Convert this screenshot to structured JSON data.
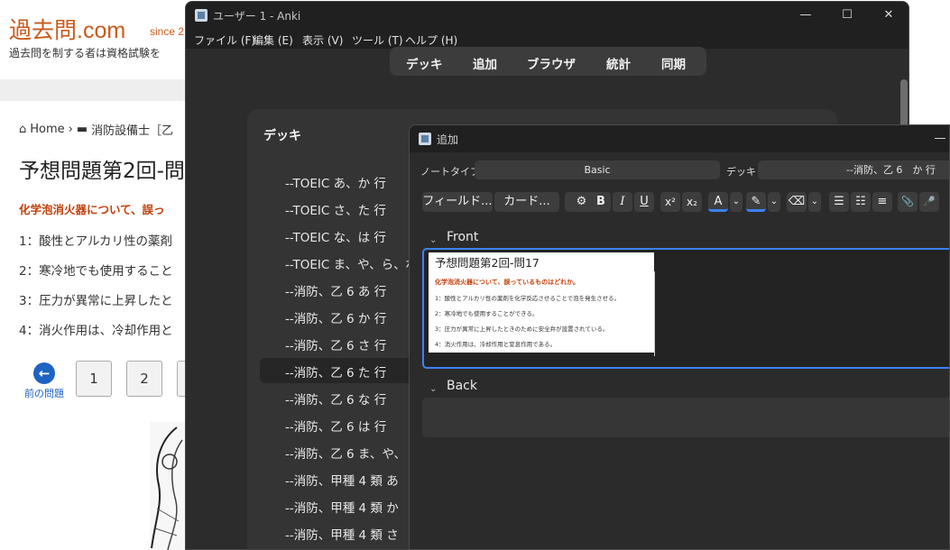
{
  "website": {
    "logo": "過去問.com",
    "since": "since 2",
    "tagline": "過去問を制する者は資格試験を",
    "breadcrumb": {
      "home": "Home",
      "sep": "›",
      "category": "消防設備士［乙"
    },
    "title": "予想問題第2回-問",
    "question": "化学泡消火器について、誤っ",
    "options": [
      "1：酸性とアルカリ性の薬剤",
      "2：寒冷地でも使用すること",
      "3：圧力が異常に上昇したと",
      "4：消火作用は、冷却作用と"
    ],
    "prev_label": "前の問題",
    "pages": [
      "1",
      "2"
    ]
  },
  "anki": {
    "window_title": "ユーザー 1 - Anki",
    "controls": {
      "minimize": "—",
      "maximize": "☐",
      "close": "✕"
    },
    "menu": [
      "ファイル (F)",
      "編集 (E)",
      "表示 (V)",
      "ツール (T)",
      "ヘルプ (H)"
    ],
    "tabs": [
      "デッキ",
      "追加",
      "ブラウザ",
      "統計",
      "同期"
    ],
    "deck_header": "デッキ",
    "decks": [
      "--TOEIC あ、か 行",
      "--TOEIC さ、た 行",
      "--TOEIC な、は 行",
      "--TOEIC ま、や、ら、わ",
      "--消防、乙 6 あ 行",
      "--消防、乙 6 か 行",
      "--消防、乙 6 さ 行",
      "--消防、乙 6 た 行",
      "--消防、乙 6 な 行",
      "--消防、乙 6 は 行",
      "--消防、乙 6 ま、や、",
      "--消防、甲種 4 類 あ",
      "--消防、甲種 4 類 か",
      "--消防、甲種 4 類 さ"
    ],
    "selected_deck_index": 7
  },
  "add_dialog": {
    "title": "追加",
    "minimize": "—",
    "notetype_label": "ノートタイプ",
    "notetype_value": "Basic",
    "deck_label": "デッキ",
    "deck_value": "--消防、乙 6　か 行",
    "toolbar": {
      "fields": "フィールド...",
      "cards": "カード...",
      "settings_icon": "⚙",
      "bold": "B",
      "italic": "I",
      "underline": "U",
      "superscript": "x²",
      "subscript": "x₂",
      "text_color": "A",
      "highlight": "✎",
      "eraser": "⌫",
      "dropdown": "⌄",
      "bullet_list": "☰",
      "numbered_list": "☷",
      "align": "≡",
      "attach": "📎",
      "record": "🎤"
    },
    "front_label": "Front",
    "back_label": "Back",
    "chevron": "⌄",
    "front_image": {
      "title": "予想問題第2回-問17",
      "question": "化学泡消火器について、誤っているものはどれか。",
      "options": [
        "1：酸性とアルカリ性の薬剤を化学反応させることで泡を発生させる。",
        "2：寒冷地でも使用することができる。",
        "3：圧力が異常に上昇したときのために安全弁が設置されている。",
        "4：消火作用は、冷却作用と窒息作用である。"
      ]
    }
  },
  "colors": {
    "accent_blue": "#3b82f6",
    "site_orange": "#c85a1e",
    "dark_bg": "#2c2c2c"
  }
}
